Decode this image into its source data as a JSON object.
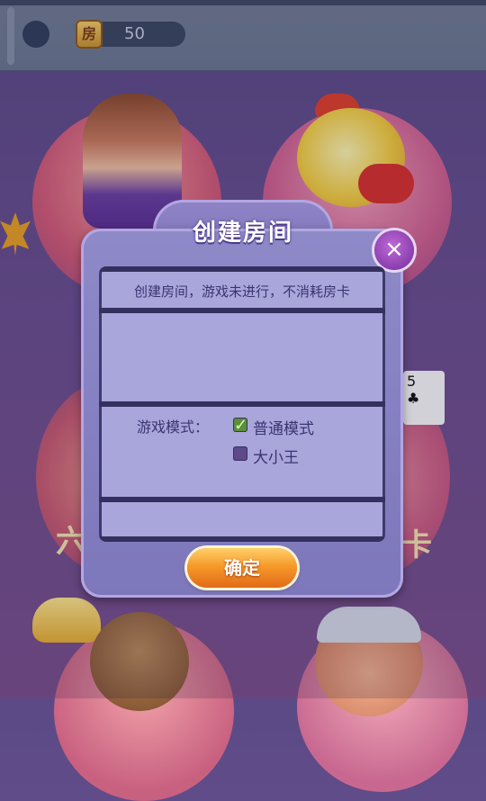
{
  "header": {
    "room_card_icon_char": "房",
    "room_card_count": "50",
    "avatar_icon": "avatar-circle"
  },
  "background": {
    "left_glyph": "六",
    "right_glyph": "卡",
    "card_rank": "5",
    "card_suit": "♣"
  },
  "dialog": {
    "title": "创建房间",
    "notice": "创建房间，游戏未进行，不消耗房卡",
    "mode_label": "游戏模式：",
    "options": [
      {
        "label": "普通模式",
        "checked": true
      },
      {
        "label": "大小王",
        "checked": false
      }
    ],
    "confirm_label": "确定",
    "close_icon": "×"
  },
  "colors": {
    "dialog_bg": "#8e8ac8",
    "panel_bg": "#a9a6dc",
    "confirm_orange": "#f69a2a",
    "close_purple": "#8a3eae"
  }
}
